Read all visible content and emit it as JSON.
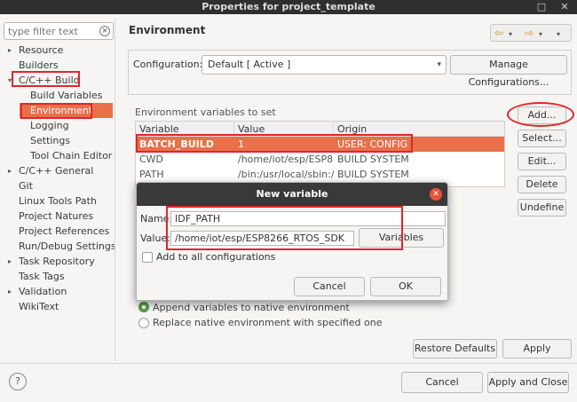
{
  "window": {
    "title": "Properties for project_template",
    "minimize_glyph": "□",
    "close_glyph": "✕"
  },
  "sidebar": {
    "filter_placeholder": "type filter text",
    "clear_glyph": "×",
    "items": [
      {
        "label": "Resource",
        "arrow": "▸"
      },
      {
        "label": "Builders",
        "arrow": ""
      },
      {
        "label": "C/C++ Build",
        "arrow": "▾"
      },
      {
        "label": "Build Variables",
        "arrow": ""
      },
      {
        "label": "Environment",
        "arrow": ""
      },
      {
        "label": "Logging",
        "arrow": ""
      },
      {
        "label": "Settings",
        "arrow": ""
      },
      {
        "label": "Tool Chain Editor",
        "arrow": ""
      },
      {
        "label": "C/C++ General",
        "arrow": "▸"
      },
      {
        "label": "Git",
        "arrow": ""
      },
      {
        "label": "Linux Tools Path",
        "arrow": ""
      },
      {
        "label": "Project Natures",
        "arrow": ""
      },
      {
        "label": "Project References",
        "arrow": ""
      },
      {
        "label": "Run/Debug Settings",
        "arrow": ""
      },
      {
        "label": "Task Repository",
        "arrow": "▸"
      },
      {
        "label": "Task Tags",
        "arrow": ""
      },
      {
        "label": "Validation",
        "arrow": "▸"
      },
      {
        "label": "WikiText",
        "arrow": ""
      }
    ]
  },
  "main": {
    "title": "Environment",
    "nav": {
      "back": "⇦",
      "forward": "⇨",
      "dropdown": "▾"
    },
    "configuration_label": "Configuration:",
    "configuration_value": "Default  [ Active ]",
    "manage_button": "Manage Configurations...",
    "env_label": "Environment variables to set",
    "columns": [
      "Variable",
      "Value",
      "Origin"
    ],
    "rows": [
      {
        "variable": "BATCH_BUILD",
        "value": "1",
        "origin": "USER: CONFIG"
      },
      {
        "variable": "CWD",
        "value": "/home/iot/esp/ESP82",
        "origin": "BUILD SYSTEM"
      },
      {
        "variable": "PATH",
        "value": "/bin:/usr/local/sbin:/u",
        "origin": "BUILD SYSTEM"
      }
    ],
    "side_buttons": [
      "Add...",
      "Select...",
      "Edit...",
      "Delete",
      "Undefine"
    ],
    "radio_append": "Append variables to native environment",
    "radio_replace": "Replace native environment with specified one",
    "restore_defaults": "Restore Defaults",
    "apply": "Apply"
  },
  "footer": {
    "help_glyph": "?",
    "cancel": "Cancel",
    "apply_close": "Apply and Close"
  },
  "dialog": {
    "title": "New variable",
    "close_glyph": "✕",
    "name_label": "Name:",
    "name_value": "IDF_PATH",
    "value_label": "Value:",
    "value_value": "/home/iot/esp/ESP8266_RTOS_SDK",
    "variables_button": "Variables",
    "add_to_all": "Add to all configurations",
    "cancel": "Cancel",
    "ok": "OK"
  }
}
